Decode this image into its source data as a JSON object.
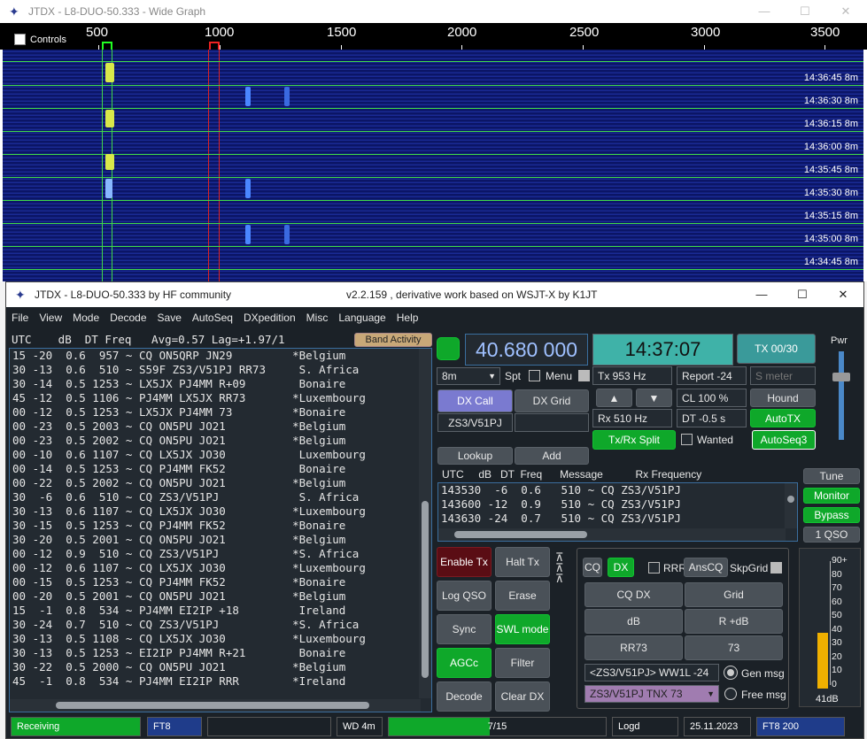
{
  "wide_graph": {
    "title": "JTDX - L8-DUO-50.333 - Wide Graph",
    "controls_label": "Controls",
    "scale": [
      "500",
      "1000",
      "1500",
      "2000",
      "2500",
      "3000",
      "3500"
    ],
    "times": [
      "14:36:45   8m",
      "14:36:30   8m",
      "14:36:15   8m",
      "14:36:00   8m",
      "14:35:45   8m",
      "14:35:30   8m",
      "14:35:15   8m",
      "14:35:00   8m",
      "14:34:45   8m"
    ]
  },
  "main": {
    "title_left": "JTDX - L8-DUO-50.333  by HF community",
    "title_center": "v2.2.159 , derivative work based on WSJT-X by K1JT",
    "menu": [
      "File",
      "View",
      "Mode",
      "Decode",
      "Save",
      "AutoSeq",
      "DXpedition",
      "Misc",
      "Language",
      "Help"
    ],
    "decode_header": "UTC    dB  DT Freq   Avg=0.57 Lag=+1.97/1",
    "band_activity": "Band Activity",
    "decodes": [
      "15 -20  0.6  957 ~ CQ ON5QRP JN29         *Belgium",
      "30 -13  0.6  510 ~ S59F ZS3/V51PJ RR73     S. Africa",
      "30 -14  0.5 1253 ~ LX5JX PJ4MM R+09        Bonaire",
      "45 -12  0.5 1106 ~ PJ4MM LX5JX RR73       *Luxembourg",
      "00 -12  0.5 1253 ~ LX5JX PJ4MM 73         *Bonaire",
      "00 -23  0.5 2003 ~ CQ ON5PU JO21          *Belgium",
      "00 -23  0.5 2002 ~ CQ ON5PU JO21          *Belgium",
      "00 -10  0.6 1107 ~ CQ LX5JX JO30           Luxembourg",
      "00 -14  0.5 1253 ~ CQ PJ4MM FK52           Bonaire",
      "00 -22  0.5 2002 ~ CQ ON5PU JO21          *Belgium",
      "30  -6  0.6  510 ~ CQ ZS3/V51PJ            S. Africa",
      "30 -13  0.6 1107 ~ CQ LX5JX JO30          *Luxembourg",
      "30 -15  0.5 1253 ~ CQ PJ4MM FK52          *Bonaire",
      "30 -20  0.5 2001 ~ CQ ON5PU JO21          *Belgium",
      "00 -12  0.9  510 ~ CQ ZS3/V51PJ           *S. Africa",
      "00 -12  0.6 1107 ~ CQ LX5JX JO30          *Luxembourg",
      "00 -15  0.5 1253 ~ CQ PJ4MM FK52          *Bonaire",
      "00 -20  0.5 2001 ~ CQ ON5PU JO21          *Belgium",
      "15  -1  0.8  534 ~ PJ4MM EI2IP +18         Ireland",
      "30 -24  0.7  510 ~ CQ ZS3/V51PJ           *S. Africa",
      "30 -13  0.5 1108 ~ CQ LX5JX JO30          *Luxembourg",
      "30 -13  0.5 1253 ~ EI2IP PJ4MM R+21        Bonaire",
      "30 -22  0.5 2000 ~ CQ ON5PU JO21          *Belgium",
      "45  -1  0.8  534 ~ PJ4MM EI2IP RRR        *Ireland"
    ],
    "frequency": "40.680 000",
    "clock": "14:37:07",
    "tx_counter": "TX 00/30",
    "pwr": "Pwr",
    "band": "8m",
    "spt": "Spt",
    "menu_label": "Menu",
    "dx_call": "DX Call",
    "dx_grid": "DX Grid",
    "dx_call_value": "ZS3/V51PJ",
    "lookup": "Lookup",
    "add": "Add",
    "tx_freq": "Tx  953  Hz",
    "rx_freq": "Rx  510  Hz",
    "report": "Report -24",
    "s_meter": "S meter",
    "cl": "CL  100 %",
    "hound": "Hound",
    "dt": "DT -0.5 s",
    "autotx": "AutoTX",
    "txrx_split": "Tx/Rx Split",
    "wanted": "Wanted",
    "autoseq3": "AutoSeq3",
    "rx_header": "UTC     dB   DT  Freq      Message           Rx Frequency",
    "rx_rows": [
      "143530  -6  0.6   510 ~ CQ ZS3/V51PJ",
      "143600 -12  0.9   510 ~ CQ ZS3/V51PJ",
      "143630 -24  0.7   510 ~ CQ ZS3/V51PJ"
    ],
    "tune": "Tune",
    "monitor": "Monitor",
    "bypass": "Bypass",
    "one_qso": "1 QSO",
    "enable_tx": "Enable Tx",
    "halt_tx": "Halt Tx",
    "log_qso": "Log QSO",
    "erase": "Erase",
    "sync": "Sync",
    "swl_mode": "SWL mode",
    "agcc": "AGCc",
    "filter": "Filter",
    "decode": "Decode",
    "clear_dx": "Clear DX",
    "cq": "CQ",
    "dx": "DX",
    "rrr": "RRR",
    "anscq": "AnsCQ",
    "skpgrid": "SkpGrid",
    "cq_dx": "CQ DX",
    "grid": "Grid",
    "db": "dB",
    "r_db": "R +dB",
    "rr73": "RR73",
    "seventy_three": "73",
    "gen_msg_value": "<ZS3/V51PJ> WW1L -24",
    "gen_msg": "Gen msg",
    "free_msg_value": "ZS3/V51PJ TNX 73",
    "free_msg": "Free msg",
    "meter_ticks": [
      "90+",
      "80",
      "70",
      "60",
      "50",
      "40",
      "30",
      "20",
      "10",
      "0"
    ],
    "meter_value": "41dB",
    "meter_level": 0.45,
    "status": {
      "receiving": "Receiving",
      "mode": "FT8",
      "wd": "WD 4m",
      "progress": "7/15",
      "logd": "Logd",
      "date": "25.11.2023",
      "mode2": "FT8  200"
    }
  }
}
